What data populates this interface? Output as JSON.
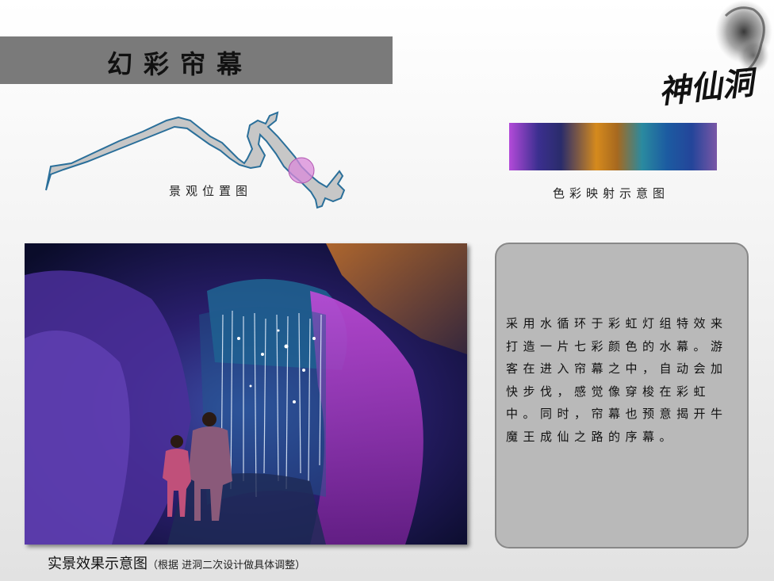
{
  "title": "幻彩帘幕",
  "logo_text": "神仙洞",
  "map_caption": "景观位置图",
  "color_caption": "色彩映射示意图",
  "description": "采用水循环于彩虹灯组特效来打造一片七彩颜色的水幕。游客在进入帘幕之中，自动会加快步伐，感觉像穿梭在彩虹中。同时，帘幕也预意揭开牛魔王成仙之路的序幕。",
  "photo_caption": "实景效果示意图",
  "photo_note": "（根据 进洞二次设计做具体调整）",
  "colors": {
    "title_bar": "#7a7a7a",
    "river": "#2a6f9a",
    "marker": "#d98ad9",
    "desc_box": "#b9b9b9"
  }
}
